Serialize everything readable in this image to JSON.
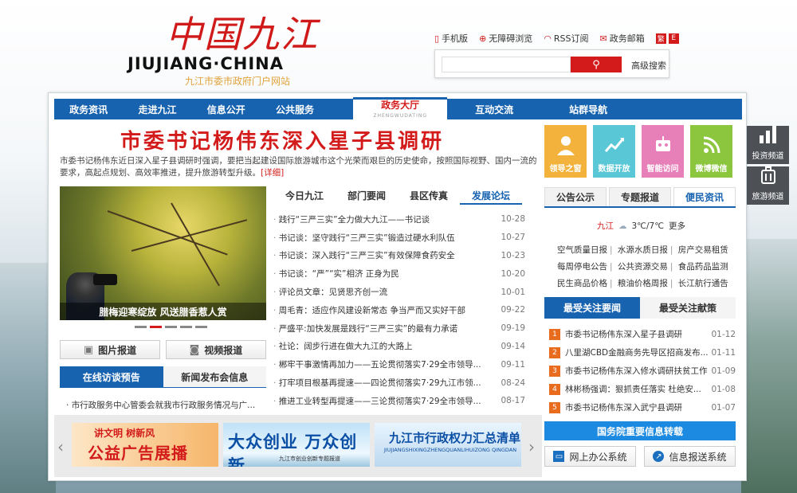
{
  "header": {
    "logo_art": "中国九江",
    "logo_en": "JIUJIANG·CHINA",
    "logo_cn": "九江市委市政府门户网站",
    "links": [
      {
        "icon": "mobile-icon",
        "label": "手机版"
      },
      {
        "icon": "accessibility-icon",
        "label": "无障碍浏览"
      },
      {
        "icon": "rss-icon",
        "label": "RSS订阅"
      },
      {
        "icon": "mail-icon",
        "label": "政务邮箱"
      }
    ],
    "lang_trad": "繁",
    "lang_en": "E",
    "search_placeholder": "",
    "search_button_icon": "search-icon",
    "advanced_search": "高级搜索"
  },
  "nav": {
    "items": [
      "政务资讯",
      "走进九江",
      "信息公开",
      "公共服务",
      "政务大厅",
      "互动交流",
      "站群导航"
    ],
    "active_sub": "ZHENGWUDATING"
  },
  "headline": {
    "title": "市委书记杨伟东深入星子县调研",
    "summary": "市委书记杨伟东近日深入星子县调研时强调，要把当起建设国际旅游城市这个光荣而艰巨的历史使命，按照国际视野、国内一流的要求，高起点规划、高效率推进，提升旅游转型升级。",
    "more": "[详细]"
  },
  "photo": {
    "caption": "腊梅迎寒绽放 风送腊香惹人赏"
  },
  "media_buttons": [
    {
      "icon": "picture-icon",
      "label": "图片报道"
    },
    {
      "icon": "camera-icon",
      "label": "视频报道"
    }
  ],
  "left_tabs": [
    "在线访谈预告",
    "新闻发布会信息"
  ],
  "left_news": "市行政服务中心管委会就我市行政服务情况与广...",
  "middle_tabs": [
    "今日九江",
    "部门要闻",
    "县区传真",
    "发展论坛"
  ],
  "news": [
    {
      "title": "践行“三严三实”全力做大九江——书记谈",
      "date": "10-28"
    },
    {
      "title": "书记谈：坚守践行“三严三实”锻造过硬水利队伍",
      "date": "10-27"
    },
    {
      "title": "书记谈：深入践行“三严三实”有效保障食药安全",
      "date": "10-23"
    },
    {
      "title": "书记谈：“严”“实”相济 正身为民",
      "date": "10-20"
    },
    {
      "title": "评论员文章：见贤思齐创一流",
      "date": "10-01"
    },
    {
      "title": "周毛青：适应作风建设新常态 争当严而又实好干部",
      "date": "09-22"
    },
    {
      "title": "严盛平:加快发展是践行“三严三实”的最有力承诺",
      "date": "09-19"
    },
    {
      "title": "社论：阔步行进在做大九江的大路上",
      "date": "09-14"
    },
    {
      "title": "郴牢干事激情再加力——五论贯彻落实7·29全市领导...",
      "date": "09-11"
    },
    {
      "title": "打牢项目根基再提速——四论贯彻落实7·29九江市领...",
      "date": "08-24"
    },
    {
      "title": "推进工业转型再提速——三论贯彻落实7·29全市领导...",
      "date": "08-17"
    }
  ],
  "banners": [
    {
      "line1": "讲文明 树新风",
      "line2": "公益广告展播"
    },
    {
      "line1": "大众创业 万众创新",
      "line2": "九江市创业创新专题报道"
    },
    {
      "line1": "九江市行政权力汇总清单",
      "line2": "JIUJIANGSHIXINGZHENGQUANLIHUIZONG QINGDAN"
    }
  ],
  "tiles": [
    {
      "label": "领导之窗",
      "color": "#f3b23c",
      "icon": "person-icon"
    },
    {
      "label": "数据开放",
      "color": "#5ac7d6",
      "icon": "chart-icon"
    },
    {
      "label": "智能访问",
      "color": "#e77fb8",
      "icon": "robot-icon"
    },
    {
      "label": "微博微信",
      "color": "#8cc63f",
      "icon": "wifi-icon"
    }
  ],
  "right_tabs": [
    "公告公示",
    "专题报道",
    "便民资讯"
  ],
  "weather": {
    "city": "九江",
    "temp": "3℃/7℃",
    "more": "更多"
  },
  "services": [
    [
      "空气质量日报",
      "水源水质日报",
      "房产交易租赁"
    ],
    [
      "每周停电公告",
      "公共资源交易",
      "食品药品监测"
    ],
    [
      "民生商品价格",
      "粮油价格周报",
      "长江航行通告"
    ]
  ],
  "rank_tabs": [
    "最受关注要闻",
    "最受关注献策"
  ],
  "rank": [
    {
      "num": "1",
      "title": "市委书记杨伟东深入星子县调研",
      "date": "01-12"
    },
    {
      "num": "2",
      "title": "八里湖CBD金融商务先导区招商发布...",
      "date": "01-11"
    },
    {
      "num": "3",
      "title": "市委书记杨伟东深入修水调研扶贫工作",
      "date": "01-09"
    },
    {
      "num": "4",
      "title": "林彬杨强调：狠抓责任落实 杜绝安...",
      "date": "01-08"
    },
    {
      "num": "5",
      "title": "市委书记杨伟东深入武宁县调研",
      "date": "01-07"
    }
  ],
  "gwy": "国务院重要信息转载",
  "systems": [
    {
      "icon": "monitor-icon",
      "label": "网上办公系统"
    },
    {
      "icon": "report-icon",
      "label": "信息报送系统"
    }
  ],
  "side": [
    {
      "icon": "bar-chart-icon",
      "label": "投资频道"
    },
    {
      "icon": "luggage-icon",
      "label": "旅游频道"
    }
  ]
}
